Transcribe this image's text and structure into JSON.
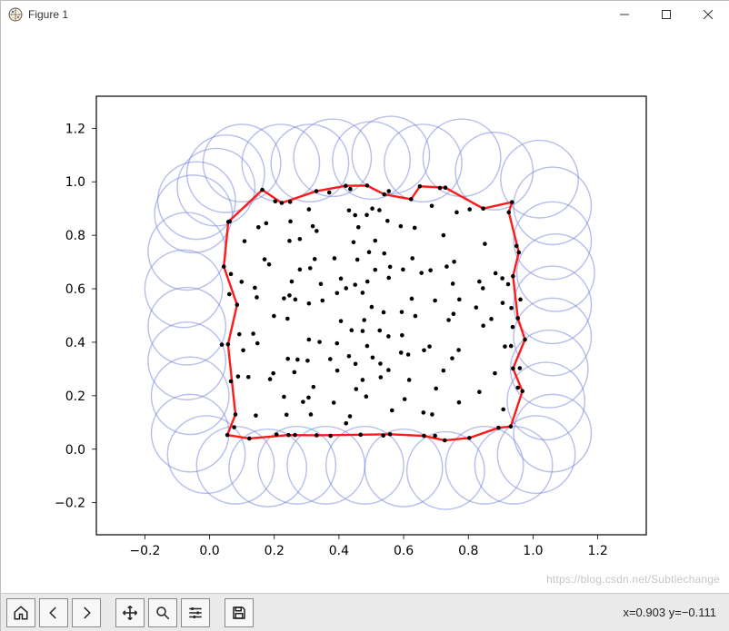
{
  "window": {
    "title": "Figure 1"
  },
  "toolbar": {
    "home": "Home",
    "back": "Back",
    "forward": "Forward",
    "pan": "Pan",
    "zoom": "Zoom",
    "subplots": "Configure subplots",
    "save": "Save",
    "cursor_readout": "x=0.903 y=−0.111"
  },
  "watermark": "https://blog.csdn.net/Subtlechange",
  "chart_data": {
    "type": "scatter",
    "title": "",
    "xlabel": "",
    "ylabel": "",
    "xlim": [
      -0.35,
      1.35
    ],
    "ylim": [
      -0.32,
      1.32
    ],
    "xticks": [
      -0.2,
      0.0,
      0.2,
      0.4,
      0.6,
      0.8,
      1.0,
      1.2
    ],
    "yticks": [
      -0.2,
      0.0,
      0.2,
      0.4,
      0.6,
      0.8,
      1.0,
      1.2
    ],
    "xtick_labels": [
      "−0.2",
      "0.0",
      "0.2",
      "0.4",
      "0.6",
      "0.8",
      "1.0",
      "1.2"
    ],
    "ytick_labels": [
      "−0.2",
      "0.0",
      "0.2",
      "0.4",
      "0.6",
      "0.8",
      "1.0",
      "1.2"
    ],
    "circle_radius": 0.12,
    "series": [
      {
        "name": "points",
        "style": "scatter",
        "color": "#000000",
        "x": [
          0.473,
          0.066,
          0.406,
          0.636,
          0.935,
          0.319,
          0.688,
          0.175,
          0.247,
          0.374,
          0.151,
          0.058,
          0.558,
          0.325,
          0.871,
          0.592,
          0.697,
          0.558,
          0.493,
          0.739,
          0.45,
          0.712,
          0.307,
          0.538,
          0.959,
          0.331,
          0.623,
          0.241,
          0.554,
          0.197,
          0.104,
          0.313,
          0.697,
          0.431,
          0.473,
          0.45,
          0.108,
          0.655,
          0.184,
          0.834,
          0.905,
          0.473,
          0.062,
          0.085,
          0.525,
          0.307,
          0.846,
          0.25,
          0.893,
          0.595,
          0.331,
          0.487,
          0.564,
          0.526,
          0.044,
          0.46,
          0.683,
          0.146,
          0.254,
          0.882,
          0.23,
          0.307,
          0.303,
          0.487,
          0.614,
          0.937,
          0.528,
          0.099,
          0.238,
          0.949,
          0.242,
          0.135,
          0.421,
          0.306,
          0.627,
          0.478,
          0.265,
          0.975,
          0.435,
          0.457,
          0.756,
          0.057,
          0.824,
          0.486,
          0.501,
          0.262,
          0.529,
          0.938,
          0.723,
          0.394,
          0.803,
          0.321,
          0.687,
          0.953,
          0.33,
          0.431,
          0.754,
          0.845,
          0.223,
          0.23,
          0.279,
          0.625,
          0.925,
          0.661,
          0.406,
          0.729,
          0.594,
          0.187,
          0.591,
          0.148,
          0.961,
          0.634,
          0.395,
          0.834,
          0.244,
          0.451,
          0.272,
          0.967,
          0.851,
          0.956,
          0.199,
          0.933,
          0.512,
          0.349,
          0.733,
          0.123,
          0.723,
          0.663,
          0.846,
          0.554,
          0.77,
          0.422,
          0.143,
          0.386,
          0.68,
          0.092,
          0.439,
          0.931,
          0.617,
          0.938,
          0.055,
          0.247,
          0.598,
          0.884,
          0.14,
          0.55,
          0.484,
          0.65,
          0.906,
          0.467,
          0.764,
          0.422,
          0.088,
          0.34,
          0.453,
          0.17,
          0.289,
          0.279,
          0.953,
          0.727,
          0.512,
          0.08,
          0.804,
          0.373,
          0.537,
          0.932,
          0.203,
          0.504,
          0.066,
          0.772,
          0.311,
          0.553,
          0.12,
          0.434,
          0.249,
          0.7,
          0.038,
          0.908,
          0.75,
          0.076,
          0.603,
          0.752,
          0.913,
          0.37,
          0.394,
          0.54,
          0.344,
          0.923,
          0.264,
          0.771,
          0.488,
          0.445,
          0.061,
          0.207,
          0.384,
          0.503,
          0.663,
          0.163,
          0.553,
          0.54
        ],
        "y": [
          0.442,
          0.254,
          0.638,
          0.498,
          0.924,
          0.834,
          0.13,
          0.845,
          0.575,
          0.05,
          0.83,
          0.85,
          0.056,
          0.711,
          0.487,
          0.361,
          0.556,
          0.682,
          0.737,
          0.483,
          0.875,
          0.977,
          0.897,
          0.512,
          0.303,
          0.052,
          0.935,
          0.488,
          0.965,
          0.284,
          0.37,
          0.13,
          0.05,
          0.348,
          0.585,
          0.615,
          0.778,
          0.659,
          0.691,
          0.627,
          0.639,
          0.259,
          0.852,
          0.54,
          0.894,
          0.545,
          0.462,
          0.852,
          0.08,
          0.426,
          0.816,
          0.986,
          0.145,
          0.444,
          0.683,
          0.83,
          0.669,
          0.568,
          0.627,
          0.284,
          0.196,
          0.41,
          0.331,
          0.386,
          0.354,
          0.457,
          0.32,
          0.626,
          0.129,
          0.76,
          0.338,
          0.432,
          0.985,
          0.193,
          0.714,
          0.483,
          0.56,
          0.41,
          0.973,
          0.709,
          0.701,
          0.392,
          0.53,
          0.876,
          0.532,
          0.288,
          0.269,
          0.302,
          0.8,
          0.584,
          0.042,
          0.233,
          0.91,
          0.23,
          0.965,
          0.893,
          0.506,
          0.602,
          0.921,
          0.564,
          0.672,
          0.563,
          0.886,
          0.137,
          0.479,
          0.978,
          0.513,
          0.262,
          0.834,
          0.396,
          0.56,
          0.828,
          0.294,
          0.214,
          0.053,
          0.319,
          0.335,
          0.217,
          0.768,
          0.736,
          0.498,
          0.528,
          0.78,
          0.556,
          0.683,
          0.04,
          0.294,
          0.05,
          0.9,
          0.641,
          0.371,
          0.097,
          0.126,
          0.714,
          0.384,
          0.43,
          0.445,
          0.085,
          0.259,
          0.647,
          0.053,
          0.779,
          0.672,
          0.658,
          0.604,
          0.854,
          0.197,
          0.983,
          0.547,
          0.054,
          0.886,
          0.602,
          0.272,
          0.401,
          0.225,
          0.71,
          0.177,
          0.786,
          0.49,
          0.033,
          0.671,
          0.13,
          0.897,
          0.337,
          0.051,
          0.386,
          0.927,
          0.343,
          0.655,
          0.56,
          0.677,
          0.422,
          0.27,
          0.123,
          0.925,
          0.227,
          0.391,
          0.149,
          0.34,
          0.082,
          0.187,
          0.619,
          0.384,
          0.96,
          0.396,
          0.953,
          0.618,
          0.617,
          0.053,
          0.175,
          0.627,
          0.774,
          0.58,
          0.055,
          0.174,
          0.9,
          0.37,
          0.97,
          0.296,
          0.732
        ]
      },
      {
        "name": "alpha-hull-boundary",
        "style": "polygon",
        "color": "#ff0000",
        "x": [
          0.044,
          0.038,
          0.055,
          0.058,
          0.062,
          0.066,
          0.104,
          0.331,
          0.487,
          0.623,
          0.712,
          0.935,
          0.975,
          0.967,
          0.959,
          0.961,
          0.956,
          0.949,
          0.953,
          0.938,
          0.931,
          0.893,
          0.803,
          0.727,
          0.663,
          0.526,
          0.386,
          0.272,
          0.151,
          0.108,
          0.104,
          0.092,
          0.085,
          0.08,
          0.076,
          0.123,
          0.099,
          0.057,
          0.044
        ],
        "y": [
          0.683,
          0.391,
          0.053,
          0.85,
          0.852,
          0.655,
          0.37,
          0.052,
          0.986,
          0.935,
          0.977,
          0.924,
          0.41,
          0.217,
          0.303,
          0.56,
          0.736,
          0.76,
          0.49,
          0.302,
          0.085,
          0.08,
          0.042,
          0.033,
          0.05,
          0.444,
          0.714,
          0.335,
          0.83,
          0.778,
          0.37,
          0.43,
          0.54,
          0.13,
          0.082,
          0.04,
          0.626,
          0.392,
          0.683
        ]
      },
      {
        "name": "alpha-circles",
        "style": "circles",
        "color": "#6b7dd6",
        "x": [
          -0.06,
          -0.06,
          -0.07,
          -0.07,
          -0.08,
          -0.07,
          -0.05,
          0.02,
          0.05,
          0.1,
          0.22,
          0.31,
          0.38,
          0.5,
          0.56,
          0.66,
          0.78,
          0.88,
          1.02,
          1.06,
          1.06,
          1.07,
          1.06,
          1.06,
          1.05,
          1.04,
          1.06,
          1.01,
          0.94,
          0.85,
          0.73,
          0.6,
          0.48,
          0.36,
          0.27,
          0.18,
          0.08,
          -0.01,
          -0.04
        ],
        "y": [
          0.06,
          0.2,
          0.33,
          0.46,
          0.6,
          0.74,
          0.88,
          0.98,
          1.03,
          1.07,
          1.07,
          1.07,
          1.09,
          1.08,
          1.1,
          1.07,
          1.09,
          1.04,
          1.01,
          0.91,
          0.78,
          0.66,
          0.54,
          0.42,
          0.3,
          0.18,
          0.06,
          -0.02,
          -0.06,
          -0.06,
          -0.08,
          -0.07,
          -0.06,
          -0.06,
          -0.06,
          -0.07,
          -0.06,
          -0.02,
          0.93
        ]
      }
    ]
  }
}
